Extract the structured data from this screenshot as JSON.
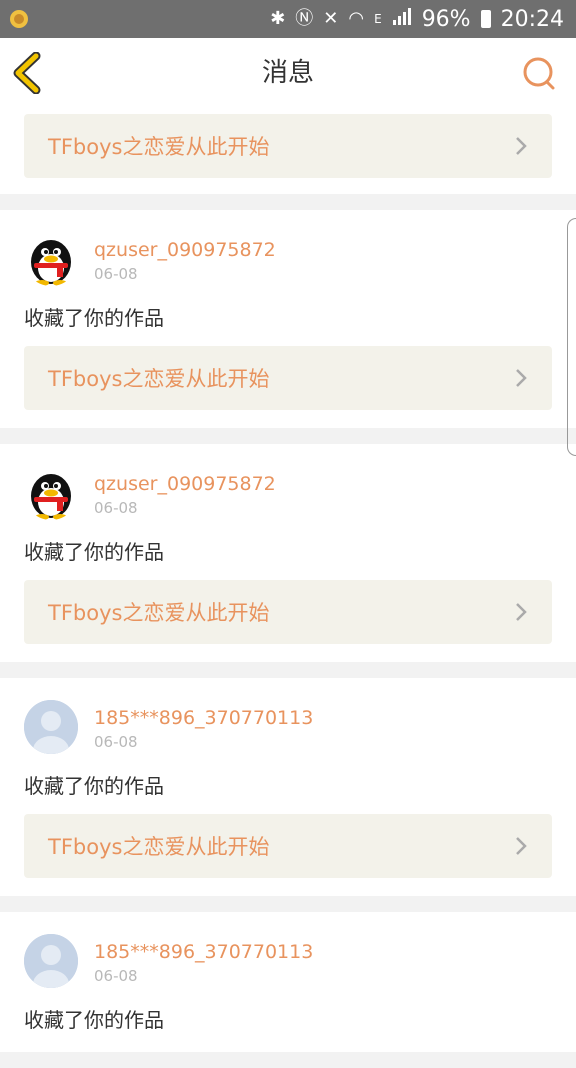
{
  "statusbar": {
    "battery": "96%",
    "time": "20:24",
    "network": "E"
  },
  "header": {
    "title": "消息"
  },
  "messages": [
    {
      "work_title": "TFboys之恋爱从此开始"
    },
    {
      "user": "qzuser_090975872",
      "date": "06-08",
      "action": "收藏了你的作品",
      "work_title": "TFboys之恋爱从此开始",
      "avatar": "penguin"
    },
    {
      "user": "qzuser_090975872",
      "date": "06-08",
      "action": "收藏了你的作品",
      "work_title": "TFboys之恋爱从此开始",
      "avatar": "penguin"
    },
    {
      "user": "185***896_370770113",
      "date": "06-08",
      "action": "收藏了你的作品",
      "work_title": "TFboys之恋爱从此开始",
      "avatar": "default"
    },
    {
      "user": "185***896_370770113",
      "date": "06-08",
      "action": "收藏了你的作品",
      "avatar": "default"
    }
  ],
  "colors": {
    "accent": "#e8935e",
    "back_arrow": "#f2c400",
    "work_bg": "#f3f2ea"
  }
}
